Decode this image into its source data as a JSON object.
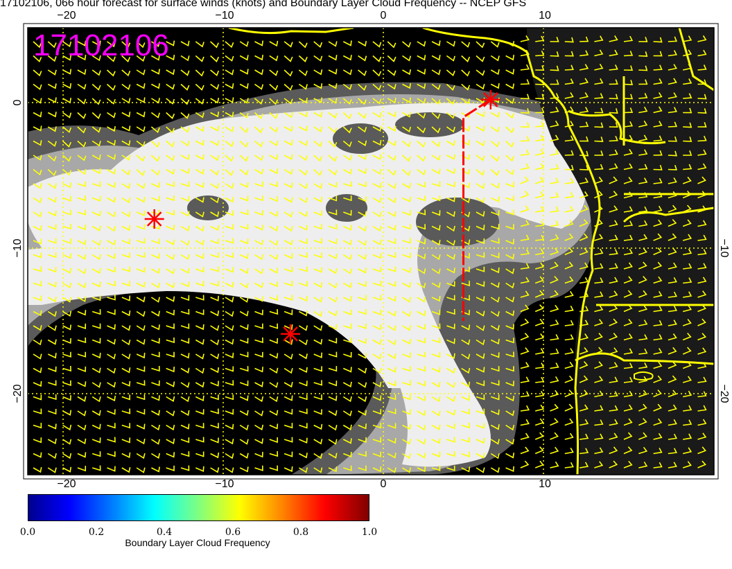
{
  "title": "17102106, 066 hour forecast for surface winds (knots) and Boundary Layer Cloud Frequency -- NCEP GFS",
  "map": {
    "stamp": "17102106",
    "lon_ticks_top": [
      "−20",
      "−10",
      "0",
      "10"
    ],
    "lon_ticks_bottom": [
      "−20",
      "−10",
      "0",
      "10"
    ],
    "lat_ticks_left": [
      "0",
      "−10",
      "−20"
    ],
    "lat_ticks_right": [
      "−10",
      "−20"
    ],
    "colors": {
      "background": "#000000",
      "cloud_high": "#eeeeee",
      "cloud_mid": "#a8a8a8",
      "cloud_low": "#5a5a5a",
      "wind_barbs": "#ffff00",
      "coastline": "#ffff00",
      "markers": "#ff0000",
      "stamp": "#ff00ff",
      "gridlines": "#ffff00"
    },
    "markers": [
      {
        "name": "marker-west",
        "lon": -14.3,
        "lat": -8.0
      },
      {
        "name": "marker-south",
        "lon": -5.8,
        "lat": -15.9
      },
      {
        "name": "marker-north",
        "lon": 6.7,
        "lat": 0.2
      }
    ],
    "flight_track": [
      [
        6.7,
        0.2
      ],
      [
        5.0,
        -1.0
      ],
      [
        5.0,
        -15.0
      ]
    ]
  },
  "colorbar": {
    "label": "Boundary Layer Cloud Frequency",
    "ticks": [
      "0.0",
      "0.2",
      "0.4",
      "0.6",
      "0.8",
      "1.0"
    ]
  }
}
